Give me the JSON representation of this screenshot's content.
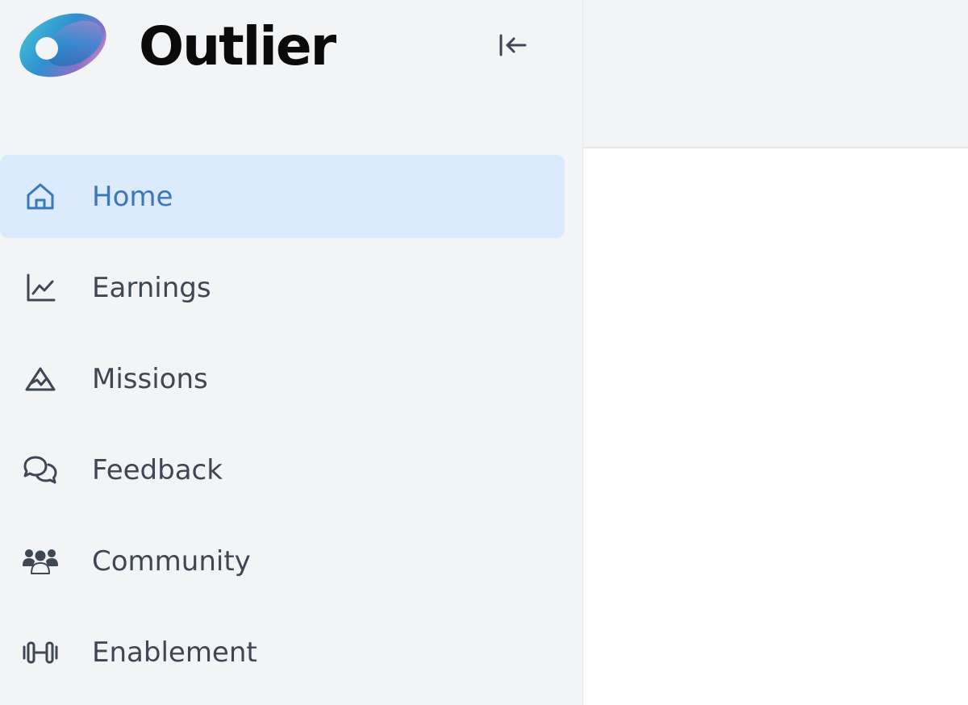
{
  "brand": {
    "name": "Outlier",
    "logo_icon": "outlier-logo-icon"
  },
  "header": {
    "collapse_icon": "collapse-sidebar-icon"
  },
  "sidebar": {
    "items": [
      {
        "label": "Home",
        "icon": "home-icon",
        "active": true
      },
      {
        "label": "Earnings",
        "icon": "chart-line-icon",
        "active": false
      },
      {
        "label": "Missions",
        "icon": "mountain-icon",
        "active": false
      },
      {
        "label": "Feedback",
        "icon": "chat-bubbles-icon",
        "active": false
      },
      {
        "label": "Community",
        "icon": "users-icon",
        "active": false
      },
      {
        "label": "Enablement",
        "icon": "dumbbell-icon",
        "active": false
      }
    ]
  },
  "colors": {
    "sidebar_bg": "#f3f4f6",
    "active_bg": "#dbeafd",
    "active_text": "#3b78b8",
    "text": "#3f4654"
  }
}
